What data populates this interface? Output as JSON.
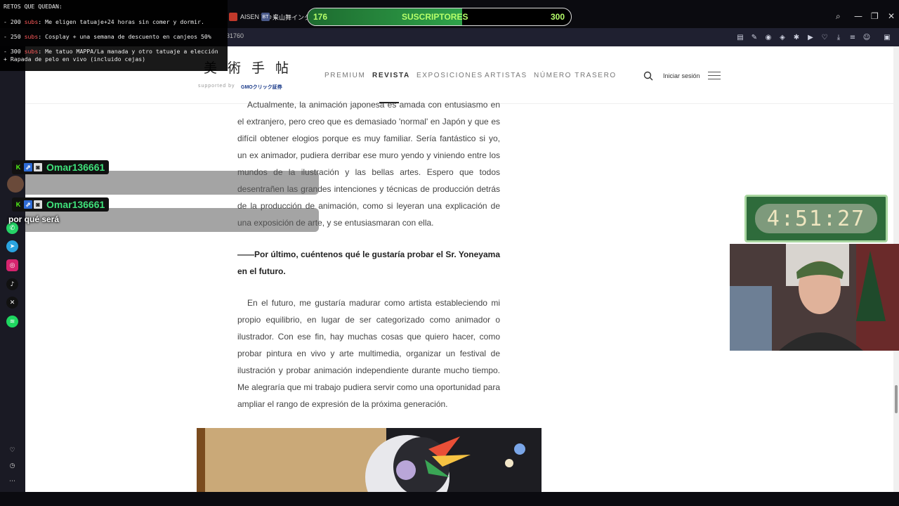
{
  "browser": {
    "tabs": [
      {
        "label": "AISEN The C",
        "favicon": "red-icon"
      },
      {
        "label": "米山舞インタビ",
        "favicon": "BT"
      }
    ],
    "url_fragment": "31760",
    "window_controls": [
      "minimize",
      "maximize",
      "close"
    ]
  },
  "stream": {
    "retos": {
      "title": "RETOS QUE QUEDAN:",
      "items": [
        {
          "prefix": "- 200 ",
          "subs": "subs",
          "text": ": Me eligen tatuaje+24 horas sin comer y dormir."
        },
        {
          "prefix": "- 250 ",
          "subs": "subs",
          "text": ": Cosplay + una semana de descuento en canjeos 50%"
        },
        {
          "prefix": "- 300 ",
          "subs": "subs",
          "text": ": Me tatuo MAPPA/La manada y otro tatuaje a elección"
        },
        {
          "prefix": "+ Rapada de pelo en vivo (incluido cejas)",
          "subs": "",
          "text": ""
        }
      ]
    },
    "subs_bar": {
      "current": "176",
      "label": "SUSCRIPTORES",
      "goal": "300",
      "progress": 0.587
    },
    "chat": [
      {
        "user": "Omar136661",
        "message": ""
      },
      {
        "user": "Omar136661",
        "message": "por qué será"
      }
    ],
    "timer": "4:51:27"
  },
  "site": {
    "logo_jp": "美術手帖",
    "supported_by": "supported by",
    "gmo": "GMOクリック証券",
    "nav": [
      "PREMIUM",
      "REVISTA",
      "EXPOSICIONES",
      "ARTISTAS",
      "NÚMERO TRASERO"
    ],
    "active_nav": "REVISTA",
    "login": "Iniciar sesión"
  },
  "article": {
    "para1": "Actualmente, la animación japonesa es amada con entusiasmo en el extranjero, pero creo que es demasiado 'normal' en Japón y que es difícil obtener elogios porque es muy familiar. Sería fantástico si yo, un ex animador, pudiera derribar ese muro yendo y viniendo entre los mundos de la ilustración y las bellas artes. Espero que todos desentrañen las grandes intenciones y técnicas de producción detrás de la producción de animación, como si leyeran una explicación de una exposición de arte, y se entusiasmaran con ella.",
    "question": "——Por último, cuéntenos qué le gustaría probar el Sr. Yoneyama en el futuro.",
    "para2": "En el futuro, me gustaría madurar como artista estableciendo mi propio equilibrio, en lugar de ser categorizado como animador o ilustrador. Con ese fin, hay muchas cosas que quiero hacer, como probar pintura en vivo y arte multimedia, organizar un festival de ilustración y probar animación independiente durante mucho tiempo. Me alegraría que mi trabajo pudiera servir como una oportunidad para ampliar el rango de expresión de la próxima generación."
  },
  "colors": {
    "accent_green": "#3fe07a",
    "subs_text": "#b6ff6a",
    "page_bg": "#ffffff"
  }
}
